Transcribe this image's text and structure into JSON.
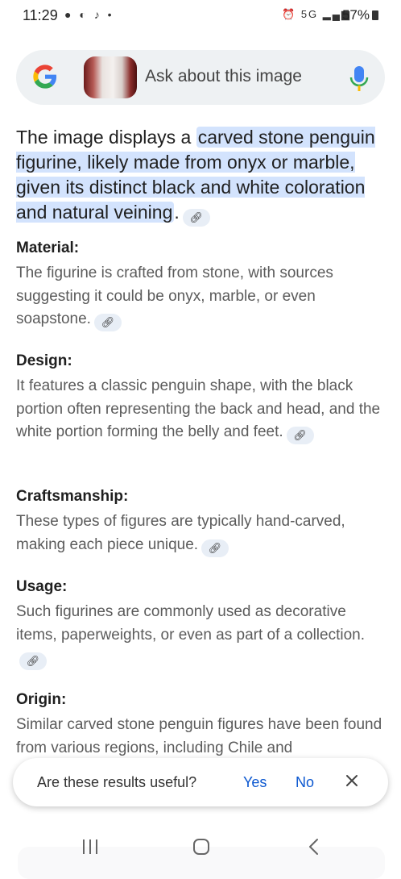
{
  "status_bar": {
    "time": "11:29",
    "left_icons": "● ◐ ♪ •",
    "right_icons": "⏰ 5G ▂▄▆",
    "battery": "57%"
  },
  "search": {
    "placeholder": "Ask about this image"
  },
  "answer": {
    "intro_plain": "The image displays a ",
    "intro_highlight": "carved stone penguin figurine, likely made from onyx or marble, given its distinct black and white coloration and natural veining",
    "intro_end": "."
  },
  "sections": [
    {
      "title": "Material:",
      "body": "The figurine is crafted from stone, with sources suggesting it could be onyx, marble, or even soapstone."
    },
    {
      "title": "Design:",
      "body": "It features a classic penguin shape, with the black portion often representing the back and head, and the white portion forming the belly and feet."
    },
    {
      "title": "Craftsmanship:",
      "body": "These types of figures are typically hand-carved, making each piece unique."
    },
    {
      "title": "Usage:",
      "body": "Such figurines are commonly used as decorative items, paperweights, or even as part of a collection."
    },
    {
      "title": "Origin:",
      "body": "Similar carved stone penguin figures have been found from various regions, including Chile and"
    }
  ],
  "feedback": {
    "question": "Are these results useful?",
    "yes": "Yes",
    "no": "No"
  },
  "colors": {
    "highlight": "#d3e3fd",
    "link_blue": "#0b57d0",
    "search_bg": "#eef1f3",
    "mic_blue": "#4285f4",
    "mic_yellow": "#fbbc04"
  }
}
